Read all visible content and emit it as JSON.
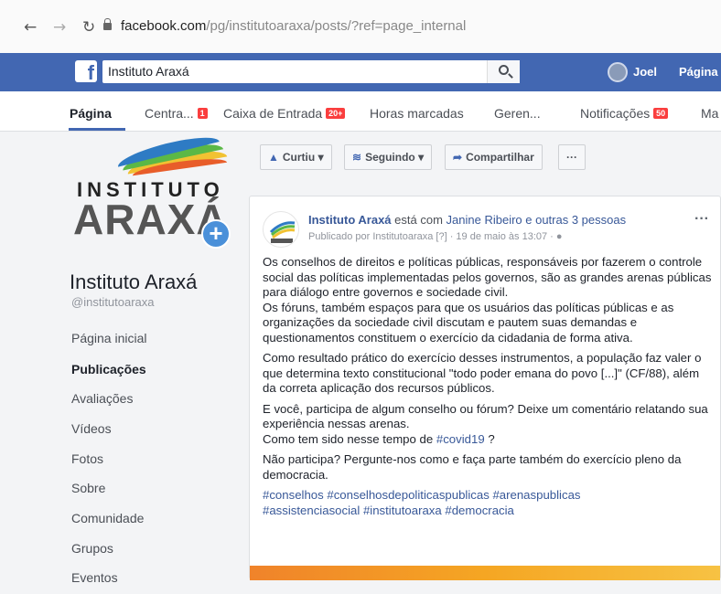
{
  "browser": {
    "back_icon": "arrow-left-icon",
    "forward_icon": "arrow-right-icon",
    "reload_icon": "reload-icon",
    "url_host": "facebook.com",
    "url_path": "/pg/institutoaraxa/posts/?ref=page_internal"
  },
  "topbar": {
    "search_value": "Instituto Araxá",
    "user_name": "Joel",
    "page_link": "Página"
  },
  "tabs": [
    {
      "label": "Página",
      "badge": ""
    },
    {
      "label": "Centra...",
      "badge": "1"
    },
    {
      "label": "Caixa de Entrada",
      "badge": "20+"
    },
    {
      "label": "Horas marcadas",
      "badge": ""
    },
    {
      "label": "Geren...",
      "badge": ""
    },
    {
      "label": "Notificações",
      "badge": "50"
    },
    {
      "label": "Ma",
      "badge": ""
    }
  ],
  "logo": {
    "line1": "INSTITUTO",
    "line2": "ARAXÁ",
    "colors": [
      "#2e7bc4",
      "#5bb846",
      "#f1c232",
      "#e85d2a"
    ]
  },
  "profile": {
    "name": "Instituto Araxá",
    "handle": "@institutoaraxa"
  },
  "sidebar": [
    "Página inicial",
    "Publicações",
    "Avaliações",
    "Vídeos",
    "Fotos",
    "Sobre",
    "Comunidade",
    "Grupos",
    "Eventos"
  ],
  "actions": {
    "like": "Curtiu",
    "follow": "Seguindo",
    "share": "Compartilhar",
    "more": "···"
  },
  "post": {
    "author": "Instituto Araxá",
    "with_text": "está com",
    "tagged": "Janine Ribeiro e outras 3 pessoas",
    "published": "Publicado por Institutoaraxa [?] · 19 de maio às 13:07 ·",
    "more": "···",
    "paragraphs": [
      "Os conselhos de direitos e políticas públicas, responsáveis por fazerem o controle social das políticas implementadas pelos governos, são as grandes arenas públicas para diálogo entre governos e sociedade civil.",
      "Os fóruns, também espaços para que os usuários das políticas públicas e as organizações da sociedade civil discutam e pautem suas demandas e questionamentos constituem o exercício da cidadania de forma ativa.",
      "Como resultado prático do exercício desses instrumentos, a população faz valer o que determina texto constitucional \"todo poder emana do povo [...]\" (CF/88), além da correta aplicação dos recursos públicos.",
      "E você, participa de algum conselho ou fórum? Deixe um comentário relatando sua experiência nessas arenas.",
      "Como tem sido nesse tempo de",
      "Não participa? Pergunte-nos como e faça parte também do exercício pleno da democracia."
    ],
    "covid_tag": "#covid19",
    "covid_suffix": " ?",
    "hashtags_1": "#conselhos #conselhosdepoliticaspublicas #arenaspublicas",
    "hashtags_2": "#assistenciasocial #institutoaraxa #democracia"
  }
}
